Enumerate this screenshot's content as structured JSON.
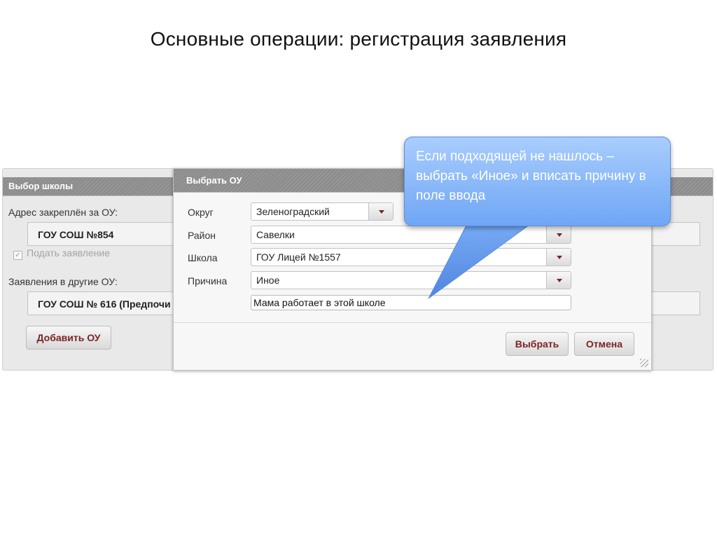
{
  "slide": {
    "title": "Основные операции: регистрация заявления"
  },
  "background_panel": {
    "header": "Выбор школы",
    "assigned_label": "Адрес закреплён за ОУ:",
    "assigned_school": "ГОУ СОШ №854",
    "submit_checkbox_label": "Подать заявление",
    "other_label": "Заявления в другие ОУ:",
    "other_school": "ГОУ СОШ № 616 (Предпочи",
    "add_button": "Добавить ОУ"
  },
  "modal": {
    "title": "Выбрать ОУ",
    "fields": {
      "okrug": {
        "label": "Округ",
        "value": "Зеленоградский"
      },
      "rayon": {
        "label": "Район",
        "value": "Савелки"
      },
      "shkola": {
        "label": "Школа",
        "value": "ГОУ Лицей №1557"
      },
      "prichina": {
        "label": "Причина",
        "value": "Иное"
      }
    },
    "reason_text": "Мама работает в этой школе",
    "select_button": "Выбрать",
    "cancel_button": "Отмена"
  },
  "callout": {
    "text": "Если подходящей не нашлось – выбрать «Иное» и вписать причину в поле ввода"
  },
  "colors": {
    "header_bg": "#8d8d8d",
    "button_text": "#7a2424",
    "callout_bg": "#7fb0f7"
  },
  "icons": {
    "dropdown": "caret-down-icon",
    "checkbox": "checkbox-checked-icon",
    "resize": "resize-grip-icon"
  }
}
